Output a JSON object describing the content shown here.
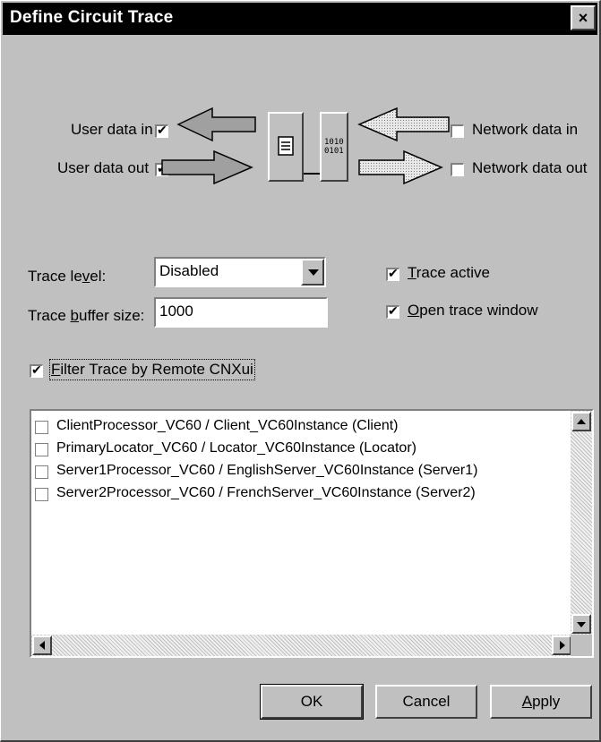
{
  "window": {
    "title": "Define Circuit Trace",
    "close_glyph": "×"
  },
  "diagram": {
    "user_data_in": {
      "label": "User data in",
      "checked": true
    },
    "user_data_out": {
      "label": "User data out",
      "checked": true
    },
    "network_data_in": {
      "label": "Network data in",
      "checked": false
    },
    "network_data_out": {
      "label": "Network data out",
      "checked": false
    },
    "module_left_icon": "document-icon",
    "module_right_icon": "binary-data-icon",
    "binary_glyph_top": "1010",
    "binary_glyph_bottom": "0101"
  },
  "trace_level": {
    "label_pre": "Trace le",
    "label_u": "v",
    "label_post": "el:",
    "value": "Disabled"
  },
  "trace_buffer": {
    "label_pre": "Trace ",
    "label_u": "b",
    "label_post": "uffer size:",
    "value": "1000"
  },
  "trace_active": {
    "label_u": "T",
    "label_post": "race active",
    "checked": true
  },
  "open_trace_window": {
    "label_u": "O",
    "label_post": "pen trace window",
    "checked": true
  },
  "filter": {
    "label_u": "F",
    "label_post": "ilter Trace by Remote CNXui",
    "checked": true
  },
  "remote_list": {
    "items": [
      {
        "label": "ClientProcessor_VC60 / Client_VC60Instance (Client)",
        "checked": false
      },
      {
        "label": "PrimaryLocator_VC60 / Locator_VC60Instance (Locator)",
        "checked": false
      },
      {
        "label": "Server1Processor_VC60 / EnglishServer_VC60Instance (Server1)",
        "checked": false
      },
      {
        "label": "Server2Processor_VC60 / FrenchServer_VC60Instance (Server2)",
        "checked": false
      }
    ]
  },
  "buttons": {
    "ok": "OK",
    "cancel": "Cancel",
    "apply_u": "A",
    "apply_post": "pply"
  }
}
